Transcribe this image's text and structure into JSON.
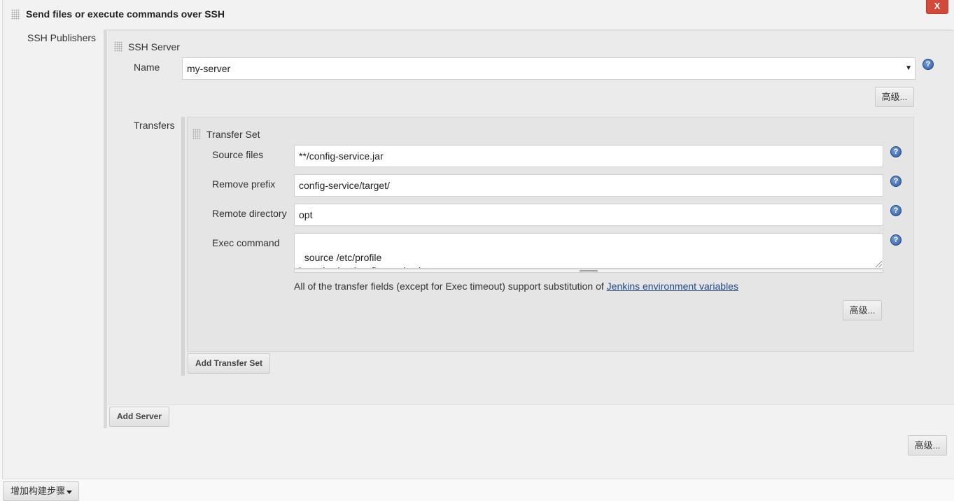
{
  "step": {
    "title": "Send files or execute commands over SSH",
    "delete_label": "X",
    "advanced_label": "高级..."
  },
  "publishers": {
    "label": "SSH Publishers",
    "add_server_label": "Add Server"
  },
  "server": {
    "section_label": "SSH Server",
    "name_label": "Name",
    "name_value": "my-server",
    "advanced_label": "高级...",
    "transfers_label": "Transfers",
    "add_transfer_label": "Add Transfer Set"
  },
  "transfer_set": {
    "section_label": "Transfer Set",
    "source_files_label": "Source files",
    "source_files_value": "**/config-service.jar",
    "remove_prefix_label": "Remove prefix",
    "remove_prefix_value": "config-service/target/",
    "remote_directory_label": "Remote directory",
    "remote_directory_value": "opt",
    "exec_command_label": "Exec command",
    "exec_command_value": "source /etc/profile\njava -jar /opt/config-service.jar",
    "help_text_prefix": "All of the transfer fields (except for Exec timeout) support substitution of ",
    "help_link": "Jenkins environment variables",
    "advanced_label": "高级..."
  },
  "footer": {
    "add_build_step_label": "增加构建步骤"
  },
  "icons": {
    "help": "help-icon",
    "drag": "drag-handle-icon",
    "dropdown": "chevron-down-icon"
  }
}
